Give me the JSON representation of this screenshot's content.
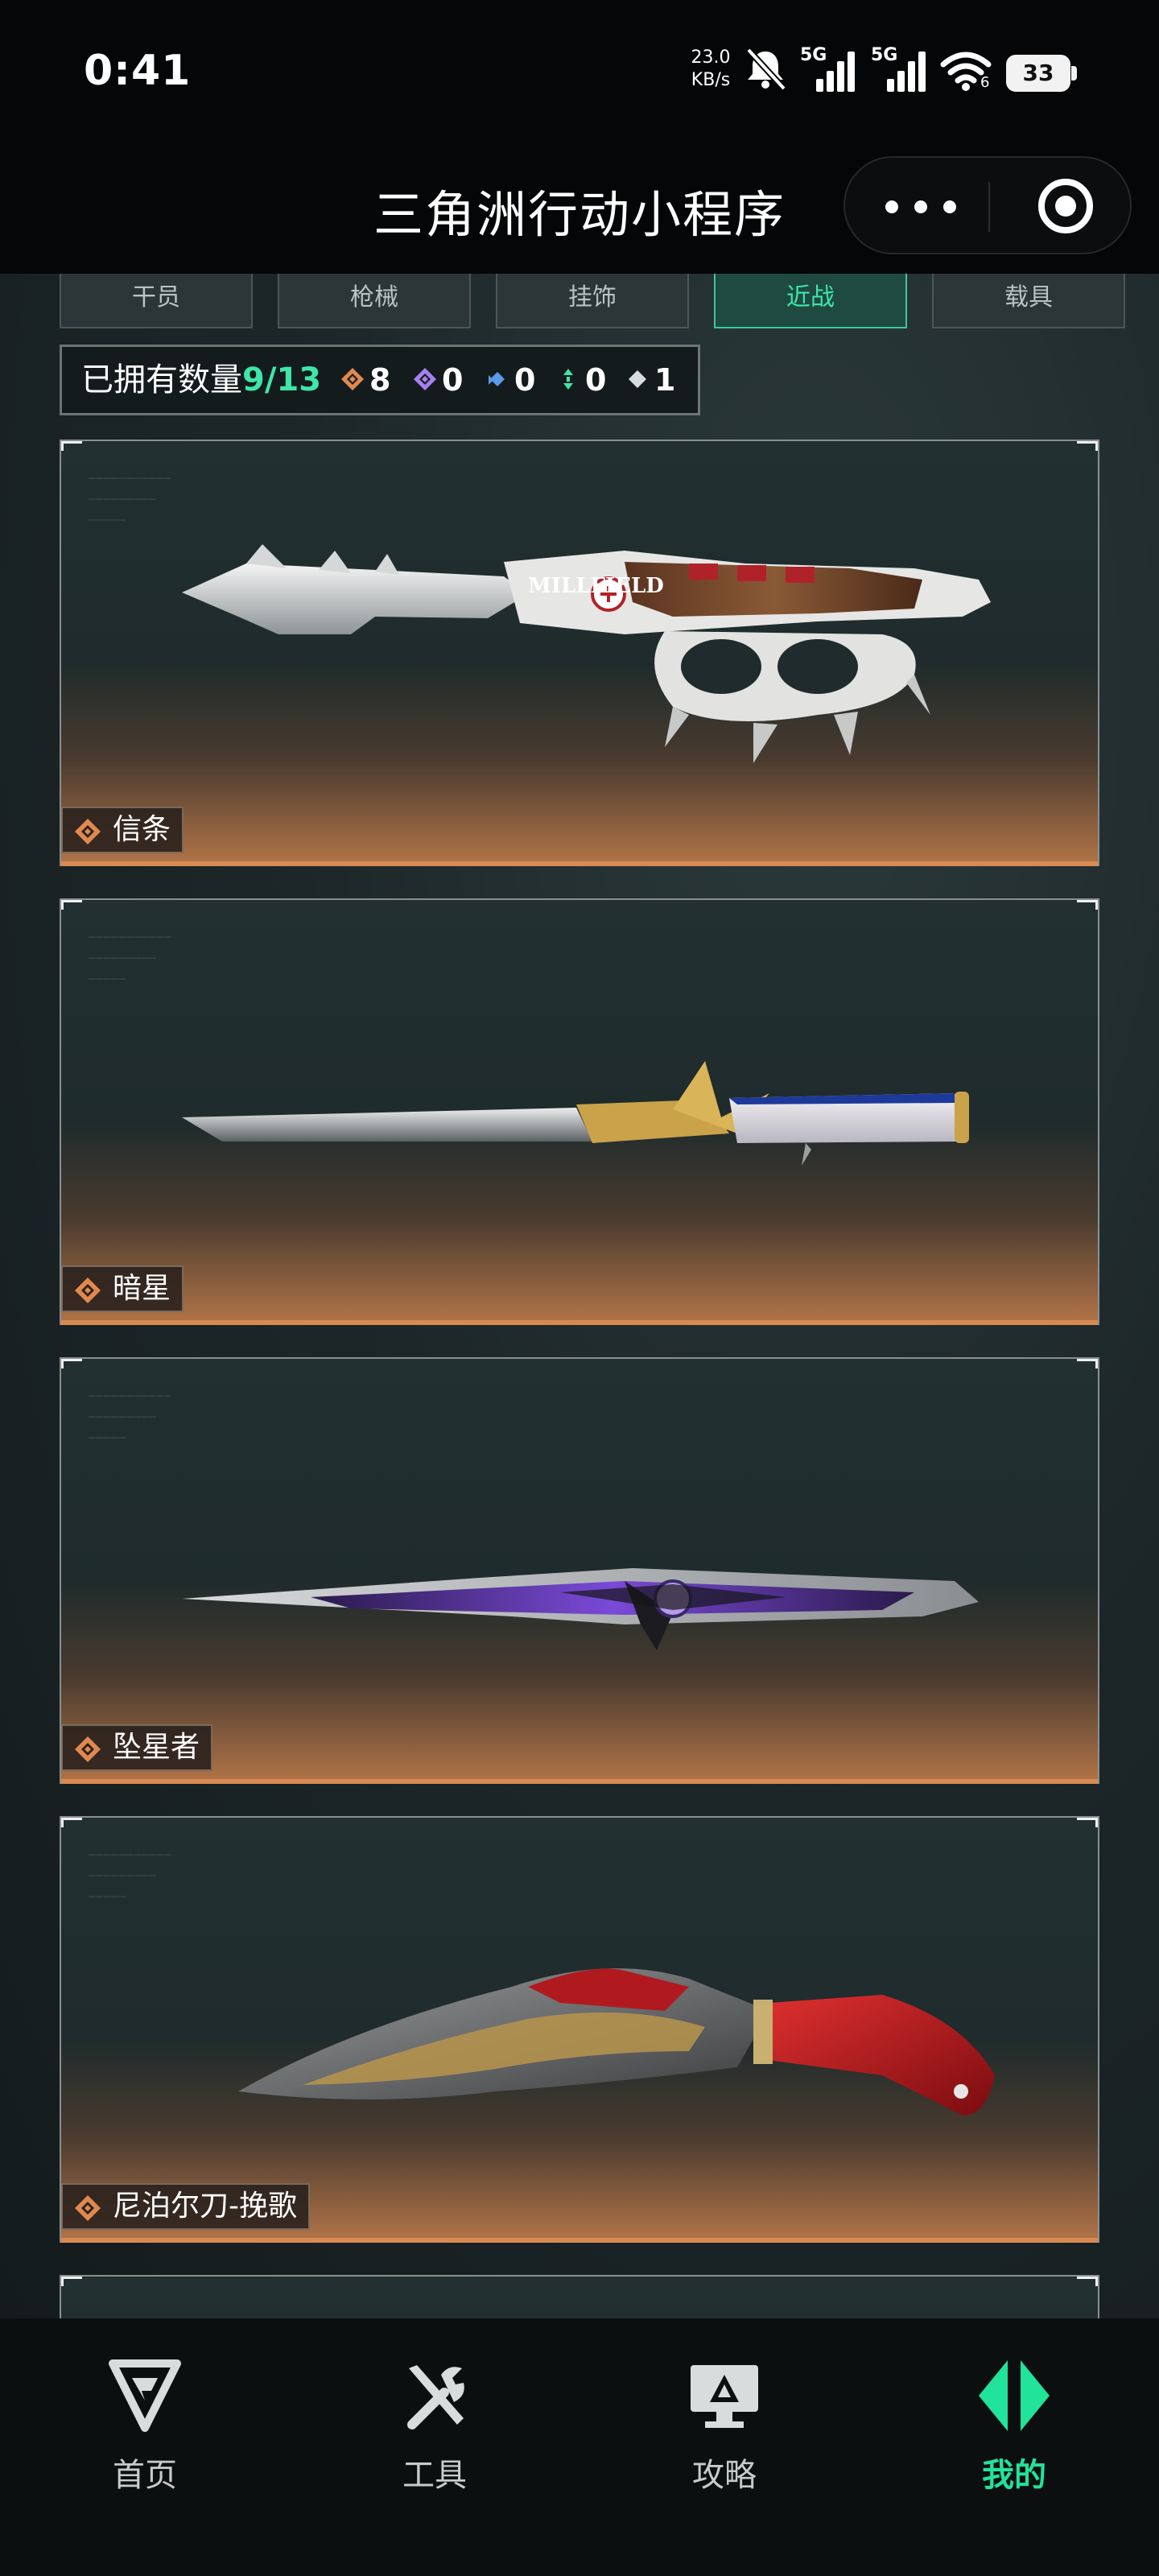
{
  "status_bar": {
    "time": "0:41",
    "net_speed_value": "23.0",
    "net_speed_unit": "KB/s",
    "signal_1_label": "5G",
    "signal_2_label": "5G",
    "wifi_label": "6",
    "battery_level": "33"
  },
  "title_bar": {
    "title": "三角洲行动小程序",
    "more_icon": "more-dots-icon",
    "close_icon": "target-circle-icon"
  },
  "tabs": [
    {
      "label": "干员",
      "active": false
    },
    {
      "label": "枪械",
      "active": false
    },
    {
      "label": "挂饰",
      "active": false
    },
    {
      "label": "近战",
      "active": true
    },
    {
      "label": "载具",
      "active": false
    }
  ],
  "owned_summary": {
    "label": "已拥有数量",
    "count": "9/13",
    "rarities": [
      {
        "icon": "orange-gem-icon",
        "color": "#e0894f",
        "count": "8"
      },
      {
        "icon": "purple-gem-icon",
        "color": "#a780f0",
        "count": "0"
      },
      {
        "icon": "blue-gem-icon",
        "color": "#5a9be8",
        "count": "0"
      },
      {
        "icon": "green-gem-icon",
        "color": "#3ee6a8",
        "count": "0"
      },
      {
        "icon": "white-gem-icon",
        "color": "#d8dcdc",
        "count": "1"
      }
    ]
  },
  "items": [
    {
      "name": "信条",
      "rarity_icon": "orange-gem-icon",
      "image": "brass-knuckle-knife-image",
      "engraving": "MILLFIELD"
    },
    {
      "name": "暗星",
      "rarity_icon": "orange-gem-icon",
      "image": "gold-wing-dagger-image"
    },
    {
      "name": "坠星者",
      "rarity_icon": "orange-gem-icon",
      "image": "purple-blade-knife-image"
    },
    {
      "name": "尼泊尔刀-挽歌",
      "rarity_icon": "orange-gem-icon",
      "image": "red-kukri-knife-image"
    }
  ],
  "bottom_nav": [
    {
      "label": "首页",
      "icon": "home-logo-icon",
      "active": false
    },
    {
      "label": "工具",
      "icon": "tools-icon",
      "active": false
    },
    {
      "label": "攻略",
      "icon": "guide-monitor-icon",
      "active": false
    },
    {
      "label": "我的",
      "icon": "profile-logo-icon",
      "active": true
    }
  ],
  "colors": {
    "accent": "#3ee6a8",
    "rarity_orange": "#e0894f",
    "card_glow": "#b37548"
  }
}
